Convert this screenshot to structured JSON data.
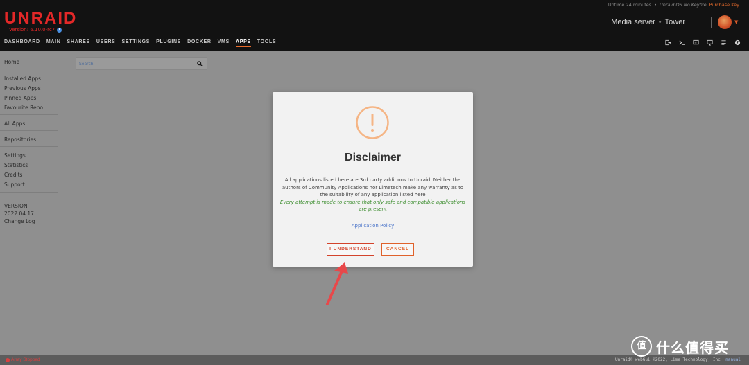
{
  "header": {
    "logo": "UNRAID",
    "version": "Version: 6.10.0-rc7",
    "uptime": "Uptime 24 minutes",
    "registration": "Unraid OS No Keyfile",
    "purchase": "Purchase Key",
    "server_name": "Media server",
    "server_tower": "Tower",
    "nav": [
      "DASHBOARD",
      "MAIN",
      "SHARES",
      "USERS",
      "SETTINGS",
      "PLUGINS",
      "DOCKER",
      "VMS",
      "APPS",
      "TOOLS"
    ],
    "active_nav": "APPS",
    "right_icons": [
      "logout-icon",
      "terminal-icon",
      "feedback-icon",
      "info-icon",
      "log-icon",
      "help-icon"
    ]
  },
  "sidebar": {
    "items": [
      "Home",
      "Installed Apps",
      "Previous Apps",
      "Pinned Apps",
      "Favourite Repo",
      "All Apps",
      "Repositories",
      "Settings",
      "Statistics",
      "Credits",
      "Support"
    ],
    "version_label": "VERSION",
    "version_value": "2022.04.17",
    "changelog": "Change Log"
  },
  "search": {
    "placeholder": "Search"
  },
  "modal": {
    "title": "Disclaimer",
    "body": "All applications listed here are 3rd party additions to Unraid. Neither the authors of Community Applications nor Limetech make any warranty as to the suitability of any application listed here",
    "italic": "Every attempt is made to ensure that only safe and compatible applications are present",
    "policy_link": "Application Policy",
    "ok_label": "I UNDERSTAND",
    "cancel_label": "CANCEL"
  },
  "footer": {
    "status": "Array Stopped",
    "copyright": "Unraid® webGui ©2022, Lime Technology, Inc",
    "manual": "manual"
  },
  "watermark": {
    "text": "什么值得买",
    "symbol": "值"
  },
  "colors": {
    "accent": "#e96c2c",
    "brand": "#e22828",
    "link": "#4a74c9",
    "success": "#3a8c2c"
  }
}
